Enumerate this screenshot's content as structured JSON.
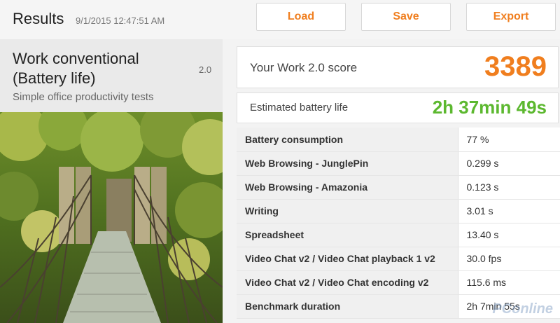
{
  "header": {
    "title": "Results",
    "timestamp": "9/1/2015 12:47:51 AM",
    "load_label": "Load",
    "save_label": "Save",
    "export_label": "Export"
  },
  "test": {
    "name": "Work conventional (Battery life)",
    "version": "2.0",
    "subtitle": "Simple office productivity tests"
  },
  "score": {
    "label": "Your Work 2.0 score",
    "value": "3389"
  },
  "battery": {
    "label": "Estimated battery life",
    "value": "2h 37min 49s"
  },
  "results": [
    {
      "metric": "Battery consumption",
      "value": "77 %"
    },
    {
      "metric": "Web Browsing - JunglePin",
      "value": "0.299 s"
    },
    {
      "metric": "Web Browsing - Amazonia",
      "value": "0.123 s"
    },
    {
      "metric": "Writing",
      "value": "3.01 s"
    },
    {
      "metric": "Spreadsheet",
      "value": "13.40 s"
    },
    {
      "metric": "Video Chat v2 / Video Chat playback 1 v2",
      "value": "30.0 fps"
    },
    {
      "metric": "Video Chat v2 / Video Chat encoding v2",
      "value": "115.6 ms"
    },
    {
      "metric": "Benchmark duration",
      "value": "2h 7min 55s"
    }
  ],
  "watermark": "PConline",
  "colors": {
    "accent": "#f07e1e",
    "battery_green": "#5cb82f"
  }
}
